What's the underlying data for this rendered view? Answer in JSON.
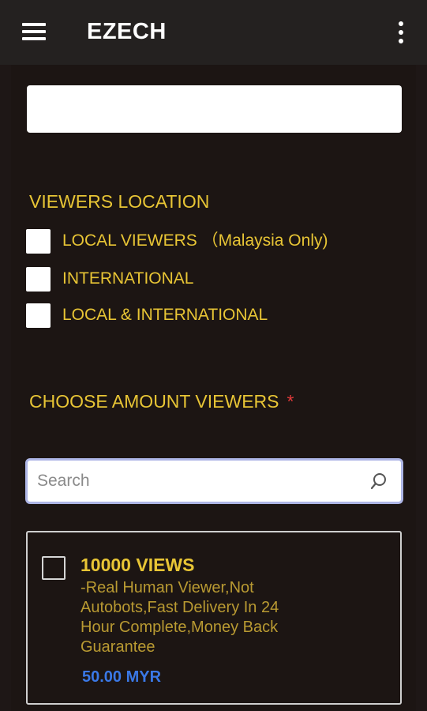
{
  "app": {
    "title": "EZECH"
  },
  "icons": {
    "menu": "hamburger-menu-icon",
    "more": "vertical-dots-icon",
    "search": "search-icon"
  },
  "form": {
    "text_field_value": ""
  },
  "location": {
    "title": "VIEWERS LOCATION",
    "options": [
      {
        "label": "LOCAL VIEWERS （Malaysia Only)",
        "checked": false
      },
      {
        "label": "INTERNATIONAL",
        "checked": false
      },
      {
        "label": "LOCAL & INTERNATIONAL",
        "checked": false
      }
    ]
  },
  "amount": {
    "title": "CHOOSE AMOUNT VIEWERS",
    "required_mark": "*"
  },
  "search": {
    "placeholder": "Search",
    "value": ""
  },
  "products": [
    {
      "title": "10000 VIEWS",
      "description": "-Real Human Viewer,Not Autobots,Fast Delivery In 24 Hour Complete,Money Back Guarantee",
      "price": "50.00 MYR",
      "checked": false
    }
  ],
  "colors": {
    "accent": "#e8c535",
    "price": "#3a78e6",
    "required": "#e23a3a",
    "background": "#1c1513",
    "topbar": "#242120"
  }
}
